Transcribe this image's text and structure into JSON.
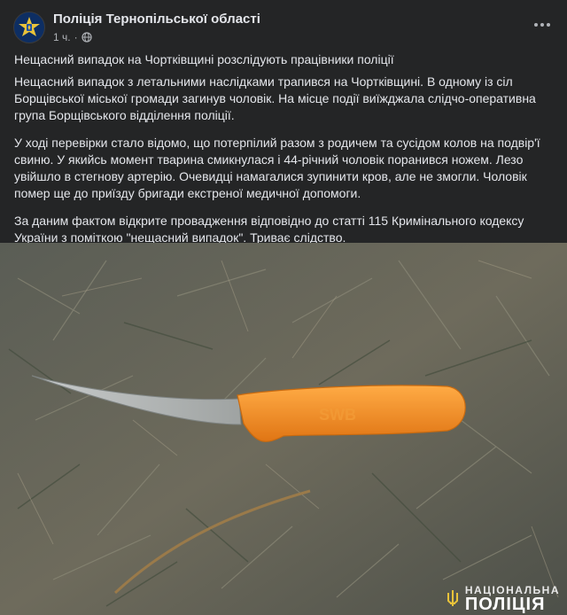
{
  "post": {
    "author": "Поліція Тернопільської області",
    "time": "1 ч.",
    "audience_icon": "globe-icon",
    "more_icon": "more-options-icon",
    "headline": "Нещасний випадок на Чортківщині розслідують працівники поліції",
    "paragraphs": [
      "Нещасний випадок з летальними наслідками трапився на Чортківщині. В одному із сіл Борщівської міської громади загинув чоловік. На місце події виїжджала слідчо-оперативна група Борщівського відділення поліції.",
      "У ході перевірки стало відомо, що потерпілий разом з родичем та сусідом колов на подвір'ї свиню. У якийсь момент тварина смикнулася і 44-річний чоловік поранився ножем. Лезо увійшло в стегнову артерію. Очевидці намагалися зупинити кров, але не змогли. Чоловік помер ще до приїзду бригади екстреної медичної допомоги.",
      "За даним фактом відкрите провадження відповідно до статті 115 Кримінального кодексу України з поміткою \"нещасний випадок\". Триває слідство."
    ]
  },
  "photo": {
    "description_icon": "knife-on-grass-photo",
    "knife_handle_text": "SWB",
    "watermark_top": "НАЦІОНАЛЬНА",
    "watermark_bottom": "ПОЛІЦІЯ"
  },
  "colors": {
    "card_bg": "#242526",
    "text": "#e4e6eb",
    "secondary": "#b0b3b8",
    "handle": "#f08a1f"
  }
}
